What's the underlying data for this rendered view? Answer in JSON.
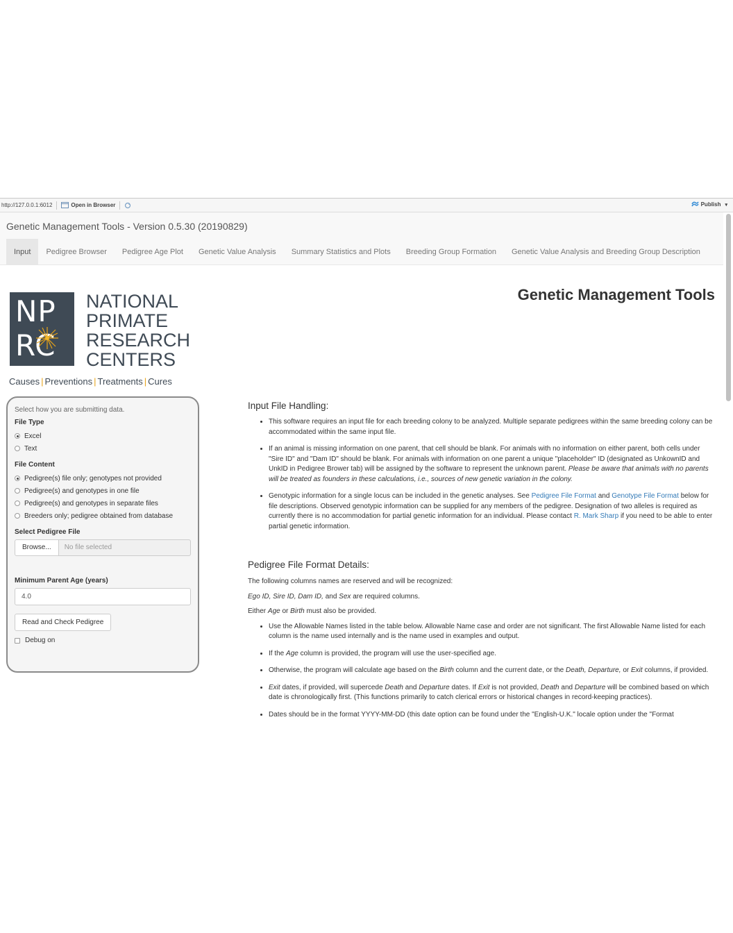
{
  "browser": {
    "url": "http://127.0.0.1:6012",
    "open_in_browser": "Open in Browser",
    "publish": "Publish"
  },
  "app": {
    "title": "Genetic Management Tools - Version 0.5.30 (20190829)",
    "tabs": [
      {
        "label": "Input",
        "active": true
      },
      {
        "label": "Pedigree Browser"
      },
      {
        "label": "Pedigree Age Plot"
      },
      {
        "label": "Genetic Value Analysis"
      },
      {
        "label": "Summary Statistics and Plots"
      },
      {
        "label": "Breeding Group Formation"
      },
      {
        "label": "Genetic Value Analysis and Breeding Group Description"
      }
    ]
  },
  "logo": {
    "np": "NP",
    "rc": "RC",
    "line1": "NATIONAL",
    "line2": "PRIMATE",
    "line3": "RESEARCH",
    "line4": "CENTERS",
    "tag1": "Causes",
    "tag2": "Preventions",
    "tag3": "Treatments",
    "tag4": "Cures",
    "brand_color": "#3f4a55",
    "accent_color": "#e8a317"
  },
  "sidebar": {
    "help": "Select how you are submitting data.",
    "file_type_label": "File Type",
    "file_type_options": [
      {
        "label": "Excel",
        "selected": true
      },
      {
        "label": "Text",
        "selected": false
      }
    ],
    "file_content_label": "File Content",
    "file_content_options": [
      {
        "label": "Pedigree(s) file only; genotypes not provided",
        "selected": true
      },
      {
        "label": "Pedigree(s) and genotypes in one file",
        "selected": false
      },
      {
        "label": "Pedigree(s) and genotypes in separate files",
        "selected": false
      },
      {
        "label": "Breeders only; pedigree obtained from database",
        "selected": false
      }
    ],
    "select_file_label": "Select Pedigree File",
    "browse_label": "Browse...",
    "file_placeholder": "No file selected",
    "min_age_label": "Minimum Parent Age (years)",
    "min_age_value": "4.0",
    "read_button": "Read and Check Pedigree",
    "debug_label": "Debug on"
  },
  "main": {
    "title": "Genetic Management Tools",
    "input_heading": "Input File Handling:",
    "input_b1": "This software requires an input file for each breeding colony to be analyzed. Multiple separate pedigrees within the same breeding colony can be accommodated within the same input file.",
    "input_b2": "If an animal is missing information on one parent, that cell should be blank. For animals with no information on either parent, both cells under \"Sire ID\" and \"Dam ID\" should be blank. For animals with information on one parent a unique \"placeholder\" ID (designated as UnkownID and UnkID in Pedigree Brower tab) will be assigned by the software to represent the unknown parent.",
    "input_b2_em": "Please be aware that animals with no parents will be treated as founders in these calculations, i.e., sources of new genetic variation in the colony.",
    "input_b3_a": "Genotypic information for a single locus can be included in the genetic analyses. See",
    "input_b3_link1": "Pedigree File Format",
    "input_b3_and": "and",
    "input_b3_link2": "Genotype File Format",
    "input_b3_b": "below for file descriptions. Observed genotypic information can be supplied for any members of the pedigree. Designation of two alleles is required as currently there is no accommodation for partial genetic information for an individual. Please contact",
    "input_b3_link3": "R. Mark Sharp",
    "input_b3_c": "if you need to be able to enter partial genetic information.",
    "ped_heading": "Pedigree File Format Details:",
    "ped_p1": "The following columns names are reserved and will be recognized:",
    "ped_p2_cols": "Ego ID, Sire ID, Dam ID,",
    "ped_p2_and": "and",
    "ped_p2_sex": "Sex",
    "ped_p2_end": "are required columns.",
    "ped_p3_a": "Either",
    "ped_p3_age": "Age",
    "ped_p3_or": "or",
    "ped_p3_birth": "Birth",
    "ped_p3_end": "must also be provided.",
    "ped_b1": "Use the Allowable Names listed in the table below. Allowable Name case and order are not significant. The first Allowable Name listed for each column is the name used internally and is the name used in examples and output.",
    "ped_b2_a": "If the",
    "ped_b2_age": "Age",
    "ped_b2_b": "column is provided, the program will use the user-specified age.",
    "ped_b3_a": "Otherwise, the program will calculate age based on the",
    "ped_b3_birth": "Birth",
    "ped_b3_b": "column and the current date, or the",
    "ped_b3_death": "Death, Departure,",
    "ped_b3_or": "or",
    "ped_b3_exit": "Exit",
    "ped_b3_c": "columns, if provided.",
    "ped_b4_exit": "Exit",
    "ped_b4_a": "dates, if provided, will supercede",
    "ped_b4_death": "Death",
    "ped_b4_and": "and",
    "ped_b4_dep": "Departure",
    "ped_b4_b": "dates. If",
    "ped_b4_exit2": "Exit",
    "ped_b4_c": "is not provided,",
    "ped_b4_death2": "Death",
    "ped_b4_and2": "and",
    "ped_b4_dep2": "Departure",
    "ped_b4_d": "will be combined based on which date is chronologically first. (This functions primarily to catch clerical errors or historical changes in record-keeping practices).",
    "ped_b5": "Dates should be in the format YYYY-MM-DD (this date option can be found under the \"English-U.K.\" locale option under the \"Format"
  }
}
